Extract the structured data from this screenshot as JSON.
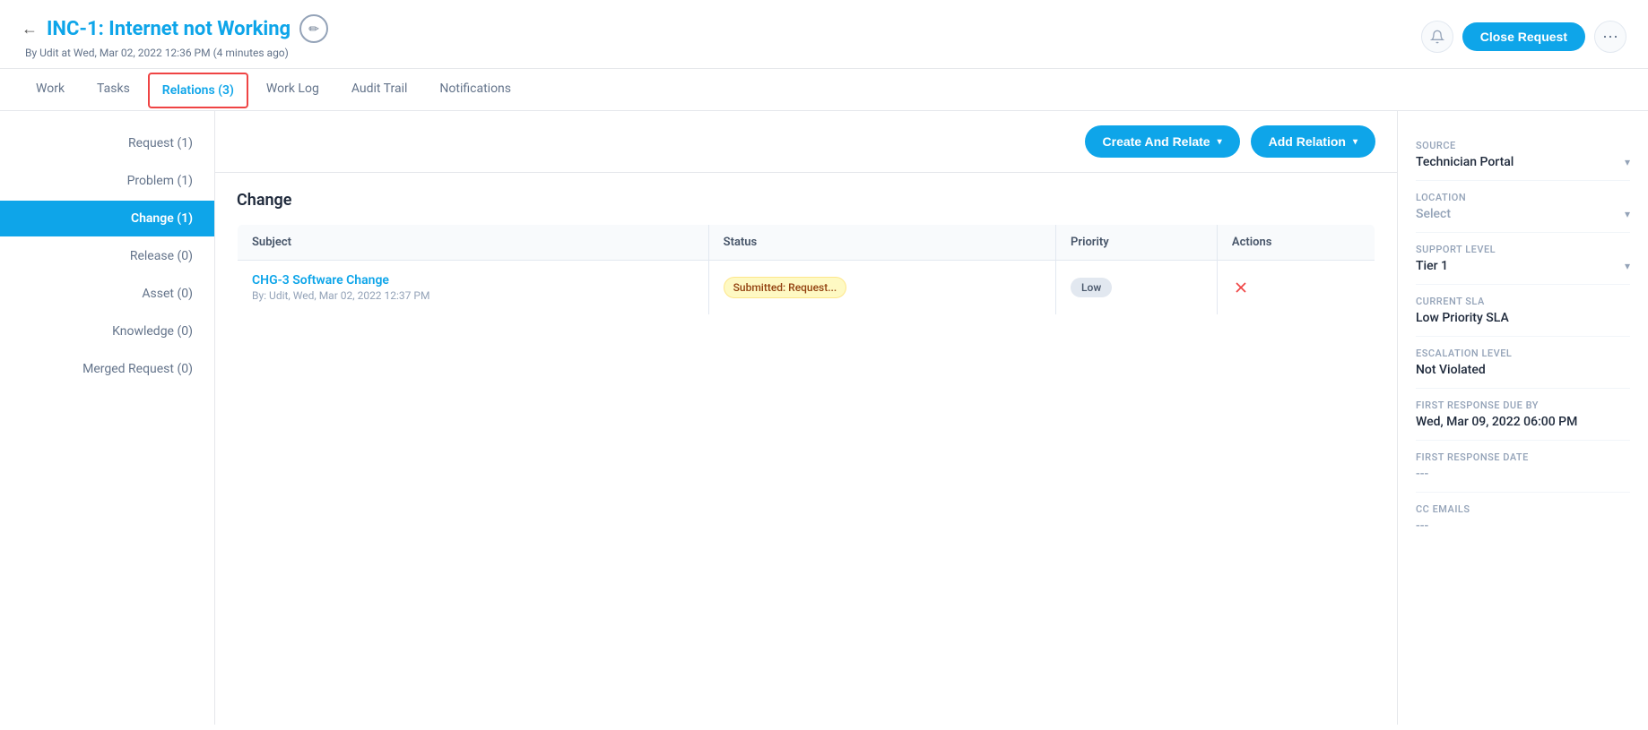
{
  "header": {
    "back_label": "←",
    "title": "INC-1: Internet not Working",
    "edit_icon": "✏",
    "meta": "By Udit at Wed, Mar 02, 2022 12:36 PM (4 minutes ago)",
    "close_request_label": "Close Request",
    "more_icon": "⋯",
    "notification_icon": "🔔"
  },
  "tabs": [
    {
      "id": "work",
      "label": "Work",
      "active": false
    },
    {
      "id": "tasks",
      "label": "Tasks",
      "active": false
    },
    {
      "id": "relations",
      "label": "Relations (3)",
      "active": true
    },
    {
      "id": "worklog",
      "label": "Work Log",
      "active": false
    },
    {
      "id": "audit",
      "label": "Audit Trail",
      "active": false
    },
    {
      "id": "notifications",
      "label": "Notifications",
      "active": false
    }
  ],
  "toolbar": {
    "create_and_relate_label": "Create And Relate",
    "add_relation_label": "Add Relation"
  },
  "relation_types": [
    {
      "id": "request",
      "label": "Request (1)",
      "active": false
    },
    {
      "id": "problem",
      "label": "Problem (1)",
      "active": false
    },
    {
      "id": "change",
      "label": "Change (1)",
      "active": true
    },
    {
      "id": "release",
      "label": "Release (0)",
      "active": false
    },
    {
      "id": "asset",
      "label": "Asset (0)",
      "active": false
    },
    {
      "id": "knowledge",
      "label": "Knowledge (0)",
      "active": false
    },
    {
      "id": "merged",
      "label": "Merged Request (0)",
      "active": false
    }
  ],
  "section": {
    "title": "Change",
    "table": {
      "columns": [
        "Subject",
        "Status",
        "Priority",
        "Actions"
      ],
      "rows": [
        {
          "subject_link": "CHG-3 Software Change",
          "subject_meta": "By: Udit, Wed, Mar 02, 2022 12:37 PM",
          "status": "Submitted: Request...",
          "status_class": "status-submitted",
          "priority": "Low",
          "actions_icon": "✕"
        }
      ]
    }
  },
  "right_panel": {
    "fields": [
      {
        "id": "source",
        "label": "Source",
        "value": "Technician Portal",
        "type": "select"
      },
      {
        "id": "location",
        "label": "Location",
        "value": "Select",
        "type": "select",
        "muted": true
      },
      {
        "id": "support_level",
        "label": "Support Level",
        "value": "Tier 1",
        "type": "select"
      },
      {
        "id": "current_sla",
        "label": "Current SLA",
        "value": "Low Priority SLA",
        "type": "text"
      },
      {
        "id": "escalation_level",
        "label": "Escalation Level",
        "value": "Not Violated",
        "type": "text"
      },
      {
        "id": "first_response_due",
        "label": "First Response Due By",
        "value": "Wed, Mar 09, 2022 06:00 PM",
        "type": "text"
      },
      {
        "id": "first_response_date",
        "label": "First Response Date",
        "value": "---",
        "type": "text"
      },
      {
        "id": "cc_emails",
        "label": "Cc Emails",
        "value": "",
        "type": "text"
      }
    ]
  }
}
